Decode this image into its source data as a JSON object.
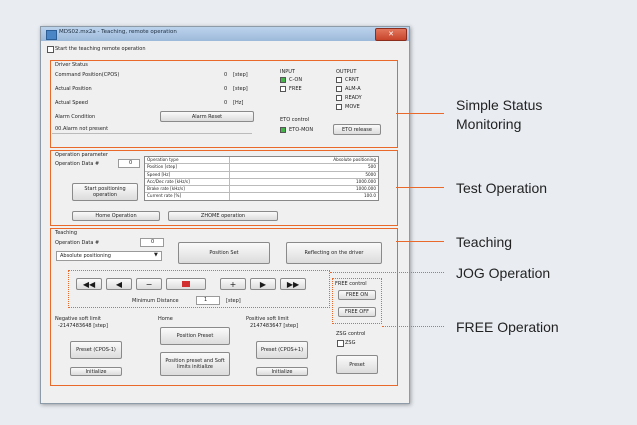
{
  "window": {
    "title": "MDS02.mx2a - Teaching, remote operation",
    "close_glyph": "✕",
    "start_checkbox_label": "Start the teaching remote operation"
  },
  "driver_status": {
    "group_label": "Driver Status",
    "rows": [
      {
        "label": "Command Position(CPOS)",
        "value": "0",
        "unit": "[step]"
      },
      {
        "label": "Actual Position",
        "value": "0",
        "unit": "[step]"
      },
      {
        "label": "Actual Speed",
        "value": "0",
        "unit": "[Hz]"
      }
    ],
    "alarm_label": "Alarm Condition",
    "alarm_reset_button": "Alarm Reset",
    "alarm_message": "00.Alarm not present",
    "input_label": "INPUT",
    "inputs": [
      {
        "label": "C-ON",
        "state": "on"
      },
      {
        "label": "FREE",
        "state": "off"
      }
    ],
    "output_label": "OUTPUT",
    "outputs": [
      "CRNT",
      "ALM-A",
      "READY",
      "MOVE"
    ],
    "eto_label": "ETO control",
    "eto_mon_label": "ETO-MON",
    "eto_release_button": "ETO release"
  },
  "operation_parameter": {
    "group_label": "Operation parameter",
    "operation_data_label": "Operation Data #",
    "operation_data_value": "0",
    "start_button": "Start positioning operation",
    "home_button": "Home Operation",
    "zhome_button": "ZHOME operation",
    "table": [
      {
        "name": "Operation type",
        "value": "Absolute positioning"
      },
      {
        "name": "Position [step]",
        "value": "500"
      },
      {
        "name": "Speed [Hz]",
        "value": "5000"
      },
      {
        "name": "Acc/Dec rate [kHz/s]",
        "value": "1000.000"
      },
      {
        "name": "Brake rate [kHz/s]",
        "value": "1000.000"
      },
      {
        "name": "Current rate [%]",
        "value": "100.0"
      }
    ]
  },
  "teaching": {
    "group_label": "Teaching",
    "operation_data_label": "Operation Data #",
    "operation_data_value": "0",
    "mode_select": "Absolute positioning",
    "position_set_button": "Position Set",
    "reflecting_button": "Reflecting on the driver",
    "minimum_distance_label": "Minimum Distance",
    "minimum_distance_value": "1",
    "minimum_distance_unit": "[step]",
    "jog_buttons": [
      "◀◀",
      "◀",
      "−",
      "■",
      "+",
      "▶",
      "▶▶"
    ],
    "free_control_label": "FREE control",
    "free_on_button": "FREE ON",
    "free_off_button": "FREE OFF",
    "negative_limit_label": "Negative soft limit",
    "negative_limit_value": "-2147483648 [step]",
    "negative_preset_button": "Preset (CPOS-1)",
    "negative_initialize_button": "Initialize",
    "home_label": "Home",
    "position_preset_button": "Position Preset",
    "preset_initialize_button": "Position preset and Soft limits initialize",
    "positive_limit_label": "Positive soft limit",
    "positive_limit_value": "2147483647 [step]",
    "positive_preset_button": "Preset (CPOS+1)",
    "positive_initialize_button": "Initialize",
    "zsg_label": "ZSG control",
    "zsg_checkbox_label": "ZSG",
    "zsg_preset_button": "Preset"
  },
  "callouts": {
    "simple_status_line1": "Simple Status",
    "simple_status_line2": "Monitoring",
    "test_operation": "Test Operation",
    "teaching": "Teaching",
    "jog_operation": "JOG Operation",
    "free_operation": "FREE Operation"
  },
  "colors": {
    "accent": "#e8692a",
    "led_on": "#46b34a",
    "background": "#e9edf2"
  }
}
